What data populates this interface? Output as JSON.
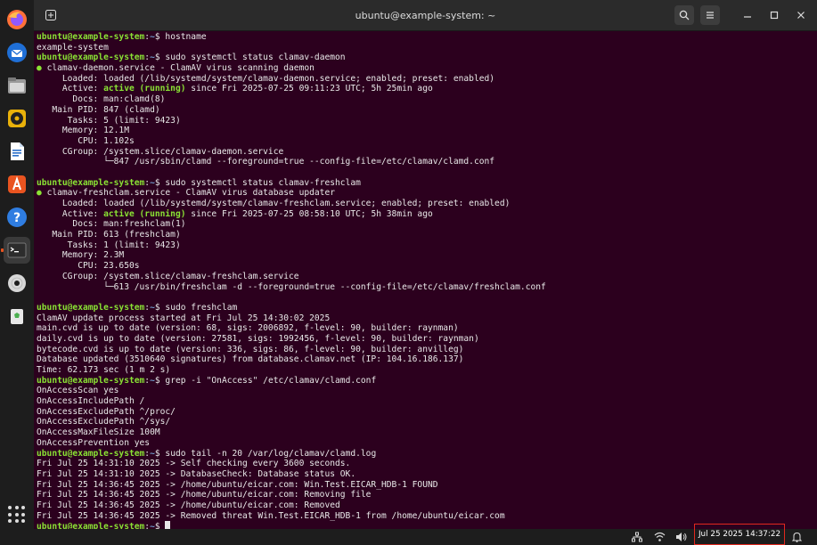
{
  "window": {
    "title": "ubuntu@example-system: ~"
  },
  "dock": {
    "items": [
      {
        "name": "firefox-icon"
      },
      {
        "name": "thunderbird-icon"
      },
      {
        "name": "files-icon"
      },
      {
        "name": "rhythmbox-icon"
      },
      {
        "name": "writer-icon"
      },
      {
        "name": "app-center-icon"
      },
      {
        "name": "help-icon"
      },
      {
        "name": "terminal-icon"
      },
      {
        "name": "disc-icon"
      },
      {
        "name": "trash-icon"
      }
    ]
  },
  "terminal": {
    "prompt_user": "ubuntu@example-system",
    "prompt_sep": ":",
    "prompt_path": "~",
    "prompt_end": "$ ",
    "lines": [
      {
        "type": "cmd",
        "text": "hostname"
      },
      {
        "type": "out",
        "text": "example-system"
      },
      {
        "type": "cmd",
        "text": "sudo systemctl status clamav-daemon"
      },
      {
        "type": "svc",
        "text": "clamav-daemon.service - ClamAV virus scanning daemon"
      },
      {
        "type": "out",
        "text": "     Loaded: loaded (/lib/systemd/system/clamav-daemon.service; enabled; preset: enabled)"
      },
      {
        "type": "act",
        "pre": "     Active: ",
        "state": "active (running)",
        "post": " since Fri 2025-07-25 09:11:23 UTC; 5h 25min ago"
      },
      {
        "type": "out",
        "text": "       Docs: man:clamd(8)"
      },
      {
        "type": "out",
        "text": "   Main PID: 847 (clamd)"
      },
      {
        "type": "out",
        "text": "      Tasks: 5 (limit: 9423)"
      },
      {
        "type": "out",
        "text": "     Memory: 12.1M"
      },
      {
        "type": "out",
        "text": "        CPU: 1.102s"
      },
      {
        "type": "out",
        "text": "     CGroup: /system.slice/clamav-daemon.service"
      },
      {
        "type": "out",
        "text": "             └─847 /usr/sbin/clamd --foreground=true --config-file=/etc/clamav/clamd.conf"
      },
      {
        "type": "out",
        "text": ""
      },
      {
        "type": "cmd",
        "text": "sudo systemctl status clamav-freshclam"
      },
      {
        "type": "svc",
        "text": "clamav-freshclam.service - ClamAV virus database updater"
      },
      {
        "type": "out",
        "text": "     Loaded: loaded (/lib/systemd/system/clamav-freshclam.service; enabled; preset: enabled)"
      },
      {
        "type": "act",
        "pre": "     Active: ",
        "state": "active (running)",
        "post": " since Fri 2025-07-25 08:58:10 UTC; 5h 38min ago"
      },
      {
        "type": "out",
        "text": "       Docs: man:freshclam(1)"
      },
      {
        "type": "out",
        "text": "   Main PID: 613 (freshclam)"
      },
      {
        "type": "out",
        "text": "      Tasks: 1 (limit: 9423)"
      },
      {
        "type": "out",
        "text": "     Memory: 2.3M"
      },
      {
        "type": "out",
        "text": "        CPU: 23.650s"
      },
      {
        "type": "out",
        "text": "     CGroup: /system.slice/clamav-freshclam.service"
      },
      {
        "type": "out",
        "text": "             └─613 /usr/bin/freshclam -d --foreground=true --config-file=/etc/clamav/freshclam.conf"
      },
      {
        "type": "out",
        "text": ""
      },
      {
        "type": "cmd",
        "text": "sudo freshclam"
      },
      {
        "type": "out",
        "text": "ClamAV update process started at Fri Jul 25 14:30:02 2025"
      },
      {
        "type": "out",
        "text": "main.cvd is up to date (version: 68, sigs: 2006892, f-level: 90, builder: raynman)"
      },
      {
        "type": "out",
        "text": "daily.cvd is up to date (version: 27581, sigs: 1992456, f-level: 90, builder: raynman)"
      },
      {
        "type": "out",
        "text": "bytecode.cvd is up to date (version: 336, sigs: 86, f-level: 90, builder: anvilleg)"
      },
      {
        "type": "out",
        "text": "Database updated (3510640 signatures) from database.clamav.net (IP: 104.16.186.137)"
      },
      {
        "type": "out",
        "text": "Time: 62.173 sec (1 m 2 s)"
      },
      {
        "type": "cmd",
        "text": "grep -i \"OnAccess\" /etc/clamav/clamd.conf"
      },
      {
        "type": "out",
        "text": "OnAccessScan yes"
      },
      {
        "type": "out",
        "text": "OnAccessIncludePath /"
      },
      {
        "type": "out",
        "text": "OnAccessExcludePath ^/proc/"
      },
      {
        "type": "out",
        "text": "OnAccessExcludePath ^/sys/"
      },
      {
        "type": "out",
        "text": "OnAccessMaxFileSize 100M"
      },
      {
        "type": "out",
        "text": "OnAccessPrevention yes"
      },
      {
        "type": "cmd",
        "text": "sudo tail -n 20 /var/log/clamav/clamd.log"
      },
      {
        "type": "out",
        "text": "Fri Jul 25 14:31:10 2025 -> Self checking every 3600 seconds."
      },
      {
        "type": "out",
        "text": "Fri Jul 25 14:31:10 2025 -> DatabaseCheck: Database status OK."
      },
      {
        "type": "out",
        "text": "Fri Jul 25 14:36:45 2025 -> /home/ubuntu/eicar.com: Win.Test.EICAR_HDB-1 FOUND"
      },
      {
        "type": "out",
        "text": "Fri Jul 25 14:36:45 2025 -> /home/ubuntu/eicar.com: Removing file"
      },
      {
        "type": "out",
        "text": "Fri Jul 25 14:36:45 2025 -> /home/ubuntu/eicar.com: Removed"
      },
      {
        "type": "out",
        "text": "Fri Jul 25 14:36:45 2025 -> Removed threat Win.Test.EICAR_HDB-1 from /home/ubuntu/eicar.com"
      },
      {
        "type": "prompt",
        "text": ""
      }
    ]
  },
  "taskbar": {
    "clock": "Jul 25 2025  14:37:22"
  },
  "colors": {
    "prompt_user": "#8ae234",
    "prompt_path": "#729fcf",
    "background": "#2c001e",
    "clock_highlight": "#e0281e"
  }
}
